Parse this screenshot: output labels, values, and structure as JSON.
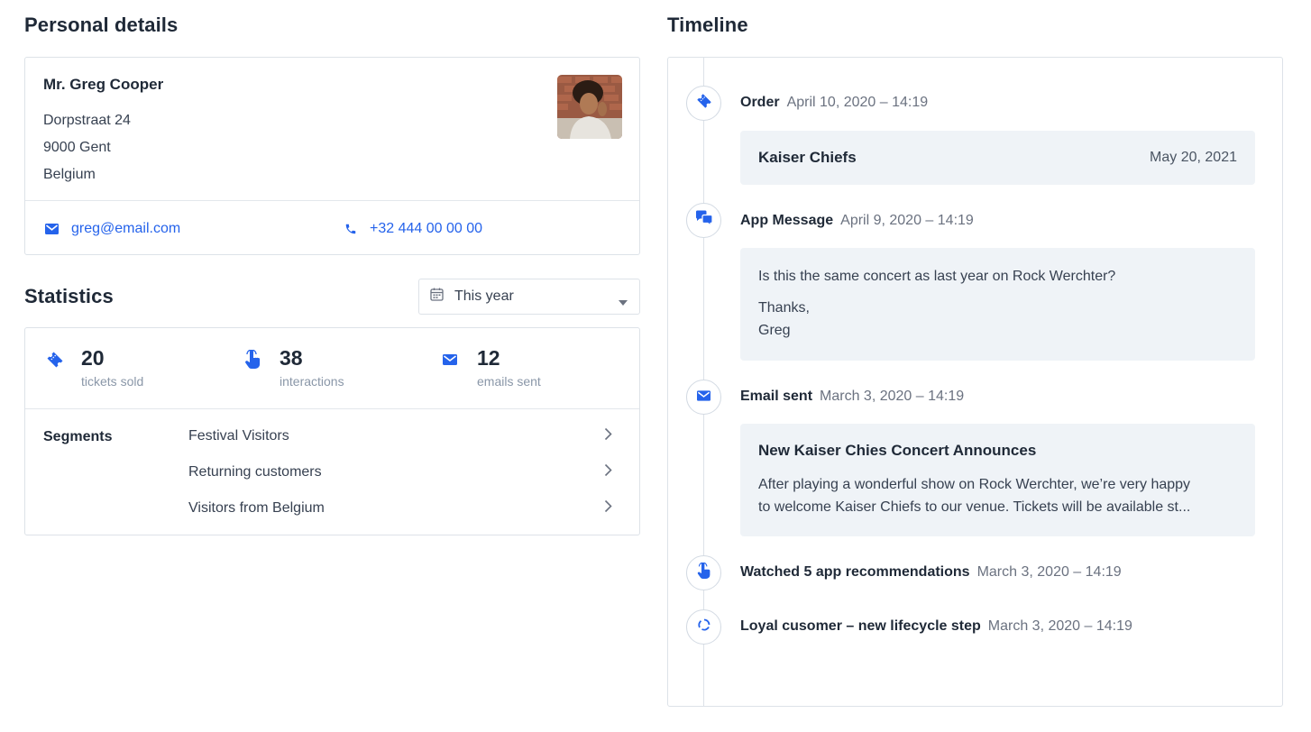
{
  "personal": {
    "title": "Personal details",
    "name": "Mr. Greg Cooper",
    "address": [
      "Dorpstraat 24",
      "9000 Gent",
      "Belgium"
    ],
    "email": "greg@email.com",
    "phone": "+32 444 00 00 00"
  },
  "statistics": {
    "title": "Statistics",
    "period": "This year",
    "stats": [
      {
        "icon": "ticket-icon",
        "value": "20",
        "caption": "tickets sold"
      },
      {
        "icon": "tap-icon",
        "value": "38",
        "caption": "interactions"
      },
      {
        "icon": "mail-icon",
        "value": "12",
        "caption": "emails sent"
      }
    ],
    "segments_title": "Segments",
    "segments": [
      "Festival Visitors",
      "Returning customers",
      "Visitors from Belgium"
    ]
  },
  "timeline": {
    "title": "Timeline",
    "events": [
      {
        "icon": "ticket-icon",
        "kind": "Order",
        "date": "April 10, 2020 – 14:19",
        "box": {
          "title": "Kaiser Chiefs",
          "date": "May 20, 2021"
        }
      },
      {
        "icon": "chat-icon",
        "kind": "App Message",
        "date": "April 9, 2020 – 14:19",
        "box": {
          "lines": [
            "Is this the same concert as last year on Rock Werchter?",
            "Thanks,",
            "Greg"
          ]
        }
      },
      {
        "icon": "mail-icon",
        "kind": "Email sent",
        "date": "March 3, 2020 – 14:19",
        "box": {
          "title": "New Kaiser Chies Concert Announces",
          "lines": [
            "After playing a wonderful show on Rock Werchter, we’re very happy",
            "to welcome Kaiser Chiefs to our venue. Tickets will be available st..."
          ]
        }
      },
      {
        "icon": "tap-icon",
        "kind": "Watched 5 app recommendations",
        "date": "March 3, 2020 – 14:19"
      },
      {
        "icon": "cycle-icon",
        "kind": "Loyal cusomer – new lifecycle step",
        "date": "March 3, 2020 – 14:19"
      }
    ]
  },
  "colors": {
    "accent": "#2563eb",
    "box_bg": "#eff3f7",
    "border": "#dde2e8"
  }
}
